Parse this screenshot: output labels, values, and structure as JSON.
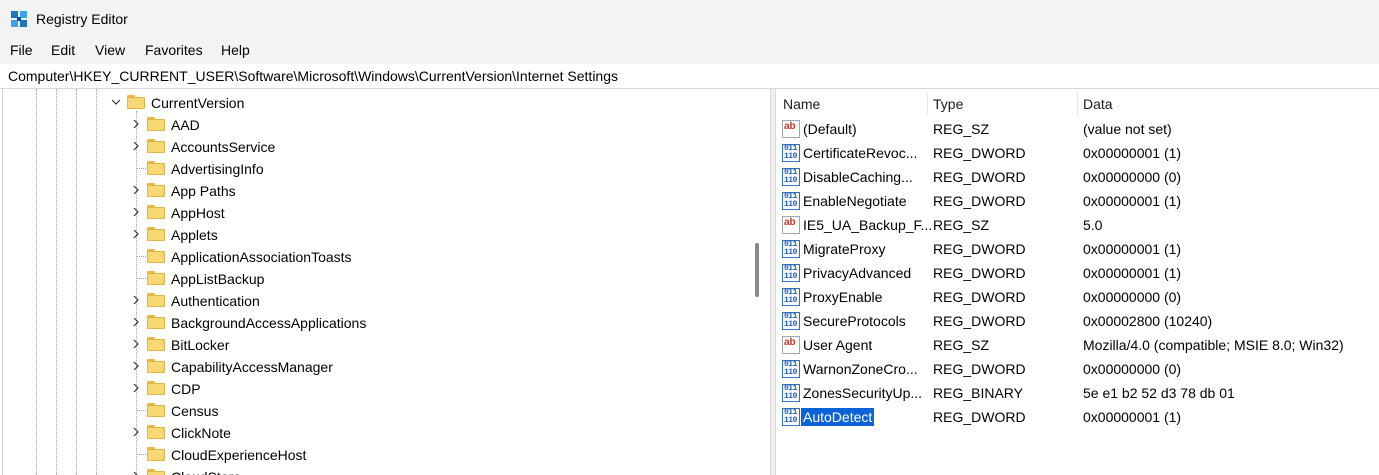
{
  "window": {
    "title": "Registry Editor"
  },
  "menu": [
    "File",
    "Edit",
    "View",
    "Favorites",
    "Help"
  ],
  "address": "Computer\\HKEY_CURRENT_USER\\Software\\Microsoft\\Windows\\CurrentVersion\\Internet Settings",
  "tree": {
    "parent": {
      "label": "CurrentVersion",
      "expanded": true
    },
    "children": [
      {
        "label": "AAD",
        "expandable": true
      },
      {
        "label": "AccountsService",
        "expandable": true
      },
      {
        "label": "AdvertisingInfo",
        "expandable": false
      },
      {
        "label": "App Paths",
        "expandable": true
      },
      {
        "label": "AppHost",
        "expandable": true
      },
      {
        "label": "Applets",
        "expandable": true
      },
      {
        "label": "ApplicationAssociationToasts",
        "expandable": false
      },
      {
        "label": "AppListBackup",
        "expandable": false
      },
      {
        "label": "Authentication",
        "expandable": true
      },
      {
        "label": "BackgroundAccessApplications",
        "expandable": true
      },
      {
        "label": "BitLocker",
        "expandable": true
      },
      {
        "label": "CapabilityAccessManager",
        "expandable": true
      },
      {
        "label": "CDP",
        "expandable": true
      },
      {
        "label": "Census",
        "expandable": false
      },
      {
        "label": "ClickNote",
        "expandable": true
      },
      {
        "label": "CloudExperienceHost",
        "expandable": false
      },
      {
        "label": "CloudStore",
        "expandable": true
      }
    ]
  },
  "columns": {
    "name": "Name",
    "type": "Type",
    "data": "Data"
  },
  "values": [
    {
      "name": "(Default)",
      "type": "REG_SZ",
      "data": "(value not set)",
      "icon": "string-value-icon"
    },
    {
      "name": "CertificateRevoc...",
      "type": "REG_DWORD",
      "data": "0x00000001 (1)",
      "icon": "binary-value-icon"
    },
    {
      "name": "DisableCaching...",
      "type": "REG_DWORD",
      "data": "0x00000000 (0)",
      "icon": "binary-value-icon"
    },
    {
      "name": "EnableNegotiate",
      "type": "REG_DWORD",
      "data": "0x00000001 (1)",
      "icon": "binary-value-icon"
    },
    {
      "name": "IE5_UA_Backup_F...",
      "type": "REG_SZ",
      "data": "5.0",
      "icon": "string-value-icon"
    },
    {
      "name": "MigrateProxy",
      "type": "REG_DWORD",
      "data": "0x00000001 (1)",
      "icon": "binary-value-icon"
    },
    {
      "name": "PrivacyAdvanced",
      "type": "REG_DWORD",
      "data": "0x00000001 (1)",
      "icon": "binary-value-icon"
    },
    {
      "name": "ProxyEnable",
      "type": "REG_DWORD",
      "data": "0x00000000 (0)",
      "icon": "binary-value-icon"
    },
    {
      "name": "SecureProtocols",
      "type": "REG_DWORD",
      "data": "0x00002800 (10240)",
      "icon": "binary-value-icon"
    },
    {
      "name": "User Agent",
      "type": "REG_SZ",
      "data": "Mozilla/4.0 (compatible; MSIE 8.0; Win32)",
      "icon": "string-value-icon"
    },
    {
      "name": "WarnonZoneCro...",
      "type": "REG_DWORD",
      "data": "0x00000000 (0)",
      "icon": "binary-value-icon"
    },
    {
      "name": "ZonesSecurityUp...",
      "type": "REG_BINARY",
      "data": "5e e1 b2 52 d3 78 db 01",
      "icon": "binary-value-icon"
    },
    {
      "name": "AutoDetect",
      "type": "REG_DWORD",
      "data": "0x00000001 (1)",
      "icon": "binary-value-icon",
      "selected": true
    }
  ],
  "colors": {
    "selection": "#0a64d8",
    "folder": "#f8d775",
    "chrome": "#f3f3f3"
  }
}
